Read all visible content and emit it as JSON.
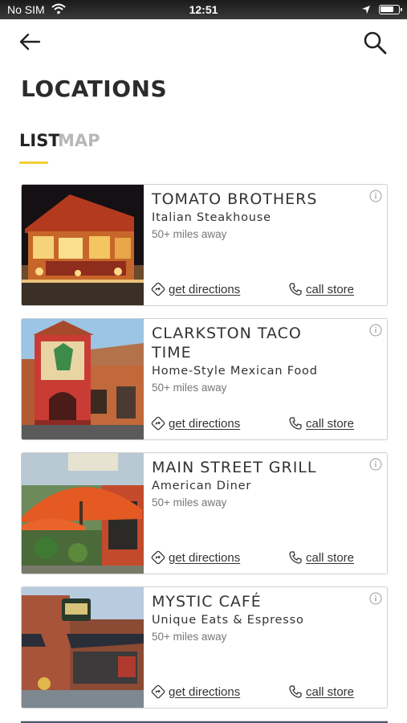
{
  "status_bar": {
    "carrier": "No SIM",
    "time": "12:51",
    "battery_level": 0.8
  },
  "header": {
    "back_icon": "arrow-left-icon",
    "search_icon": "search-icon",
    "title": "LOCATIONS"
  },
  "tabs": [
    {
      "label": "LIST",
      "active": true
    },
    {
      "label": "MAP",
      "active": false
    }
  ],
  "colors": {
    "accent": "#f2cf33",
    "tab_inactive": "#b8b8b8",
    "card_border": "#cfcfcf"
  },
  "locations": [
    {
      "name": "TOMATO BROTHERS",
      "category": "Italian Steakhouse",
      "distance": "50+ miles away",
      "directions_label": "get directions",
      "call_label": "call store"
    },
    {
      "name": "CLARKSTON TACO TIME",
      "category": "Home-Style Mexican Food",
      "distance": "50+ miles away",
      "directions_label": "get directions",
      "call_label": "call store"
    },
    {
      "name": "MAIN STREET GRILL",
      "category": "American Diner",
      "distance": "50+ miles away",
      "directions_label": "get directions",
      "call_label": "call store"
    },
    {
      "name": "MYSTIC CAFÉ",
      "category": "Unique Eats & Espresso",
      "distance": "50+ miles away",
      "directions_label": "get directions",
      "call_label": "call store"
    }
  ]
}
